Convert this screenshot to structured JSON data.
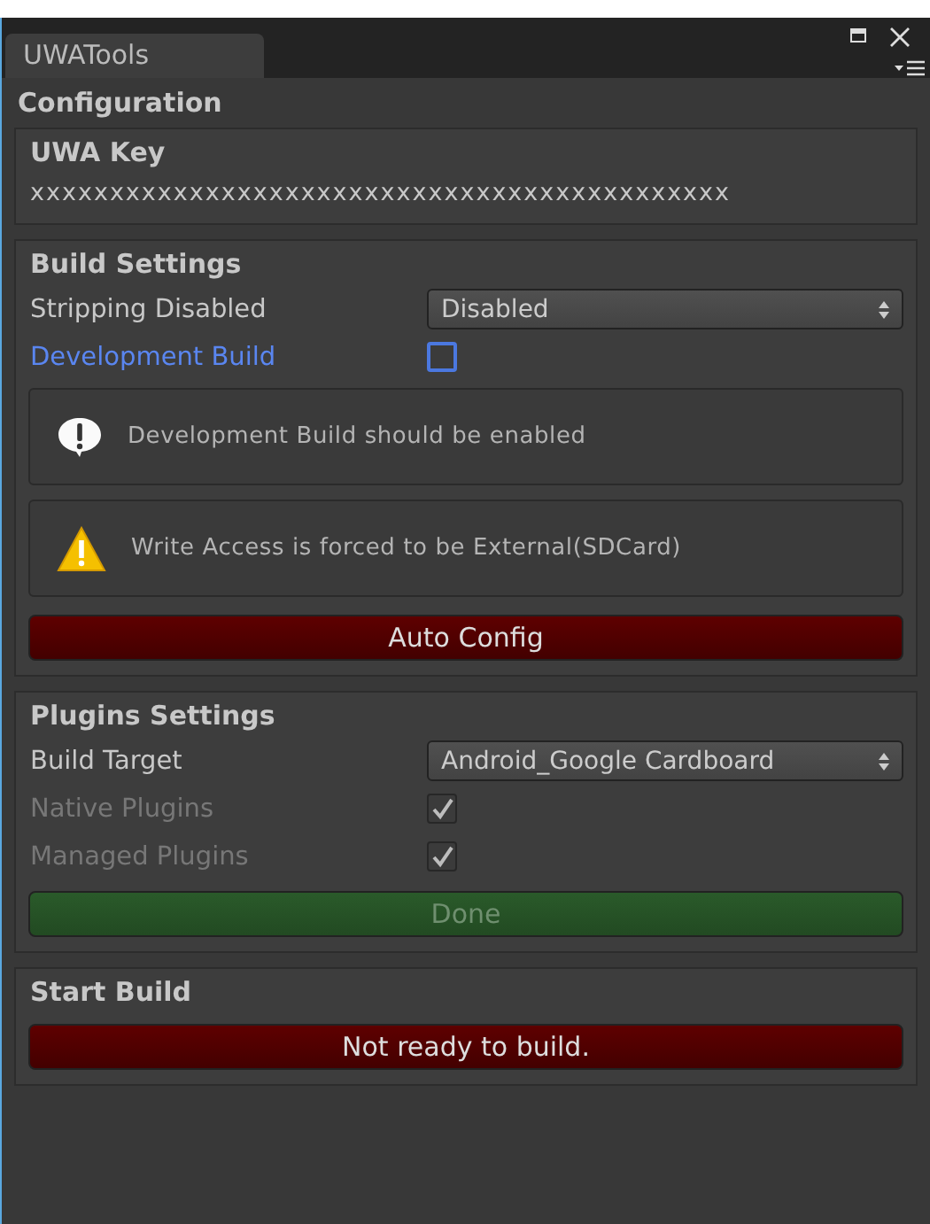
{
  "window": {
    "tab": "UWATools",
    "title": "Configuration"
  },
  "sections": [
    {
      "title": "UWA Key",
      "items": [
        {
          "kind": "text",
          "text": "xxxxxxxxxxxxxxxxxxxxxxxxxxxxxxxxxxxxxxxxxxxx"
        }
      ]
    },
    {
      "title": "Build Settings",
      "items": [
        {
          "kind": "dropdown",
          "label": "Stripping Disabled",
          "value": "Disabled",
          "focused": false,
          "disabled": false
        },
        {
          "kind": "checkbox",
          "label": "Development Build",
          "checked": false,
          "focused": true,
          "disabled": false
        },
        {
          "kind": "info",
          "text": "Development Build should be enabled"
        },
        {
          "kind": "warning",
          "text": "Write Access is forced to be External(SDCard)"
        },
        {
          "kind": "alert",
          "label": "Auto Config",
          "disabled": false
        }
      ]
    },
    {
      "title": "Plugins Settings",
      "items": [
        {
          "kind": "dropdown",
          "label": "Build Target",
          "value": "Android_Google Cardboard",
          "focused": false,
          "disabled": false
        },
        {
          "kind": "checkbox",
          "label": "Native Plugins",
          "checked": true,
          "focused": false,
          "disabled": true
        },
        {
          "kind": "checkbox",
          "label": "Managed Plugins",
          "checked": true,
          "focused": false,
          "disabled": true
        },
        {
          "kind": "confirm",
          "label": "Done",
          "disabled": true
        }
      ]
    },
    {
      "title": "Start Build",
      "items": [
        {
          "kind": "alert",
          "label": "Not ready to build.",
          "disabled": false
        }
      ]
    }
  ]
}
